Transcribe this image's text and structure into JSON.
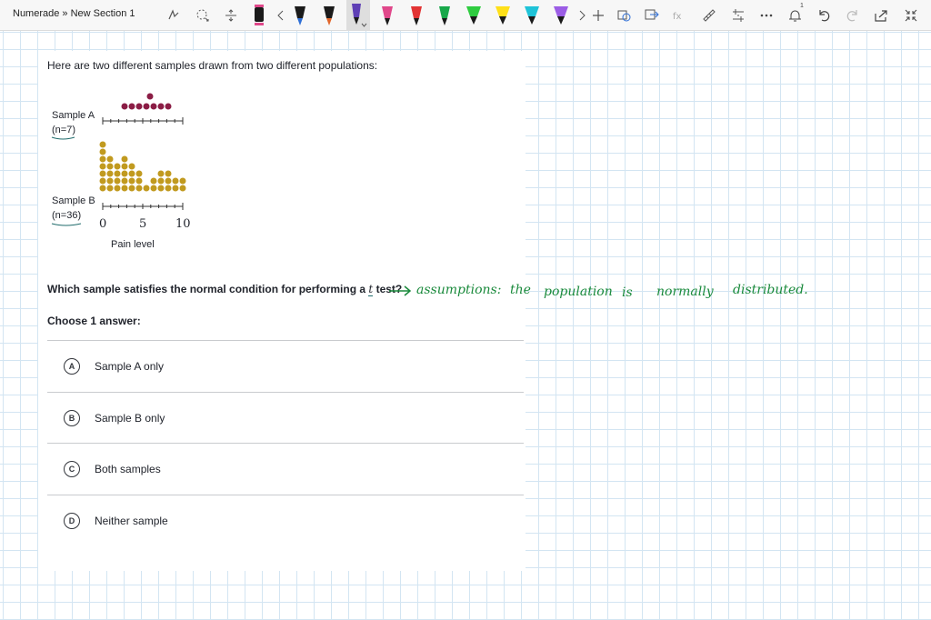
{
  "toolbar": {
    "breadcrumb": "Numerade » New Section 1",
    "pens": [
      {
        "name": "pen-black",
        "color": "#1a1a1a"
      },
      {
        "name": "pen-blue",
        "color": "#2f6fd6"
      },
      {
        "name": "pen-black-2",
        "color": "#1a1a1a"
      },
      {
        "name": "pen-purple",
        "color": "#5e3fb5"
      },
      {
        "name": "pen-pink",
        "color": "#e0478a"
      },
      {
        "name": "pen-red",
        "color": "#e23333"
      },
      {
        "name": "pen-green",
        "color": "#18a84a"
      },
      {
        "name": "pen-bright-green",
        "color": "#2fcc40"
      },
      {
        "name": "pen-yellow",
        "color": "#ffe019"
      },
      {
        "name": "pen-cyan",
        "color": "#1fc3d8"
      },
      {
        "name": "pen-violet",
        "color": "#9b5de5"
      }
    ],
    "notification_count": "1"
  },
  "question": {
    "intro": "Here are two different samples drawn from two different populations:",
    "sample_a_label": "Sample A",
    "sample_a_n": "(n=7)",
    "sample_b_label": "Sample B",
    "sample_b_n": "(n=36)",
    "tick_0": "0",
    "tick_5": "5",
    "tick_10": "10",
    "axis_label": "Pain level",
    "prompt_part1": "Which sample satisfies the normal condition for performing a",
    "prompt_t": "t",
    "prompt_part2": "test?",
    "choose": "Choose 1 answer:",
    "options": [
      {
        "letter": "A",
        "label": "Sample A only"
      },
      {
        "letter": "B",
        "label": "Sample B only"
      },
      {
        "letter": "C",
        "label": "Both samples"
      },
      {
        "letter": "D",
        "label": "Neither sample"
      }
    ]
  },
  "handwriting": {
    "w1": "assumptions:",
    "w2": "the",
    "w3": "population",
    "w4": "is",
    "w5": "normally",
    "w6": "distributed."
  },
  "colors": {
    "sample_a_dots": "#8b1d45",
    "sample_b_dots": "#c19a1f",
    "ink": "#1a8a3c"
  }
}
